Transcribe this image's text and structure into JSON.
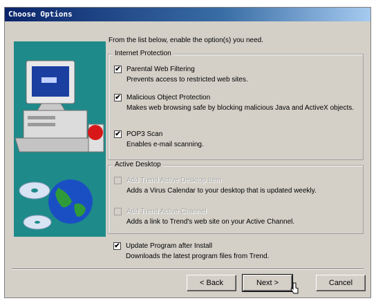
{
  "window": {
    "title": "Choose Options"
  },
  "intro": "From the list below, enable the option(s) you need.",
  "internet_protection": {
    "label": "Internet Protection",
    "options": [
      {
        "label": "Parental Web Filtering",
        "checked": true,
        "description": "Prevents access to restricted web sites."
      },
      {
        "label": "Malicious Object Protection",
        "checked": true,
        "description": "Makes web browsing safe by blocking malicious Java and ActiveX objects."
      },
      {
        "label": "POP3 Scan",
        "checked": true,
        "description": "Enables e-mail scanning."
      }
    ]
  },
  "active_desktop": {
    "label": "Active Desktop",
    "options": [
      {
        "label": "Add Trend Active Desktop Item",
        "checked": false,
        "disabled": true,
        "description": "Adds a Virus Calendar to your desktop that is updated weekly."
      },
      {
        "label": "Add Trend Active Channel",
        "checked": false,
        "disabled": true,
        "description": "Adds a link to Trend's web site on your Active Channel."
      }
    ]
  },
  "update": {
    "label": "Update Program after Install",
    "checked": true,
    "description": "Downloads the latest program files from Trend."
  },
  "buttons": {
    "back": "< Back",
    "next": "Next >",
    "cancel": "Cancel"
  },
  "check_glyph": "✔",
  "colors": {
    "title_start": "#0a246a",
    "title_end": "#a6caf0",
    "dialog_bg": "#d4d0c8",
    "art_bg": "#1f8a8a"
  }
}
